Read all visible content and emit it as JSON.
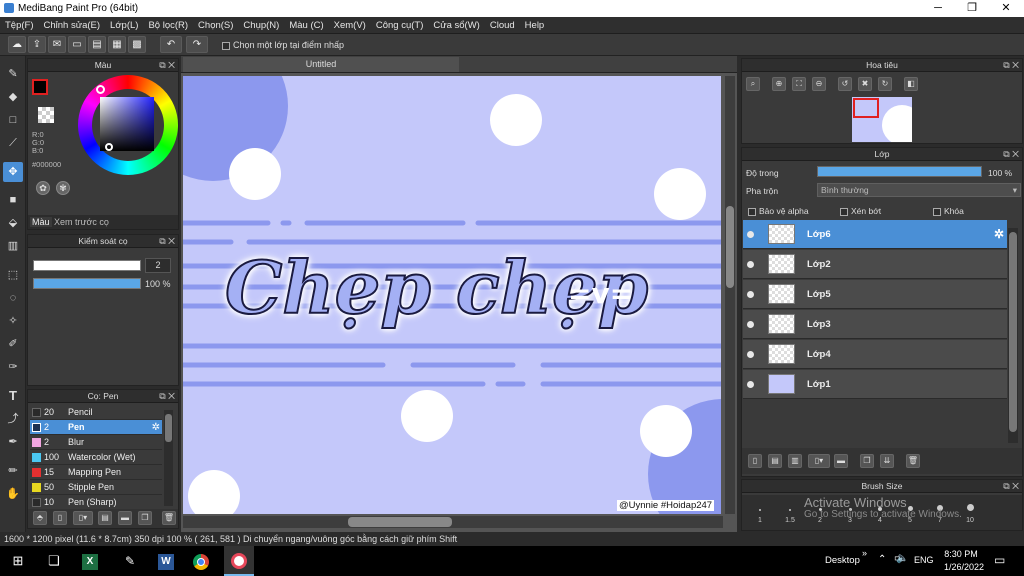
{
  "window": {
    "title": "MediBang Paint Pro (64bit)",
    "min": "─",
    "max": "❐",
    "close": "✕"
  },
  "menu": [
    "Tệp(F)",
    "Chỉnh sửa(E)",
    "Lớp(L)",
    "Bộ lọc(R)",
    "Chọn(S)",
    "Chụp(N)",
    "Màu (C)",
    "Xem(V)",
    "Công cụ(T)",
    "Cửa sổ(W)",
    "Cloud",
    "Help"
  ],
  "toolbar": {
    "checkbox_label": "Chọn một lớp tại điểm nhấp"
  },
  "color_panel": {
    "title": "Màu",
    "r": "R:0",
    "g": "G:0",
    "b": "B:0",
    "hex": "#000000",
    "tab_color": "Màu",
    "tab_preview": "Xem trước cọ",
    "fg_color": "#000000",
    "accent": "#4a8fd6"
  },
  "brush_control": {
    "title": "Kiểm soát cọ",
    "size": "2",
    "opacity": "100 %"
  },
  "brush_panel": {
    "title": "Cọ: Pen",
    "items": [
      {
        "size": "20",
        "name": "Pencil",
        "color": "#2a2a2a"
      },
      {
        "size": "2",
        "name": "Pen",
        "color": "#1d3050"
      },
      {
        "size": "2",
        "name": "Blur",
        "color": "#f2a6e0"
      },
      {
        "size": "100",
        "name": "Watercolor (Wet)",
        "color": "#4bc8f2"
      },
      {
        "size": "15",
        "name": "Mapping Pen",
        "color": "#e53030"
      },
      {
        "size": "50",
        "name": "Stipple Pen",
        "color": "#e8d820"
      },
      {
        "size": "10",
        "name": "Pen (Sharp)",
        "color": "#2a2a2a"
      }
    ]
  },
  "canvas": {
    "tab": "Untitled",
    "main_text": "Chẹp chẹp",
    "emote": "=v=",
    "watermark": "@Uynnie #Hoidap247",
    "bg": "#c4c8fa",
    "accent": "#8c98ee"
  },
  "navigator": {
    "title": "Hoa tiêu"
  },
  "layer_panel": {
    "title": "Lớp",
    "opacity_label": "Độ trong",
    "opacity_value": "100 %",
    "blend_label": "Pha trộn",
    "blend_value": "Bình thường",
    "opt_alpha": "Bảo vệ alpha",
    "opt_clip": "Xén bớt",
    "opt_lock": "Khóa",
    "layers": [
      "Lớp6",
      "Lớp2",
      "Lớp5",
      "Lớp3",
      "Lớp4",
      "Lớp1"
    ]
  },
  "brush_size": {
    "title": "Brush Size",
    "sizes": [
      "1",
      "1.5",
      "2",
      "3",
      "4",
      "5",
      "7",
      "10"
    ],
    "activate1": "Activate Windows",
    "activate2": "Go to Settings to activate Windows."
  },
  "status": {
    "text": "1600 * 1200 pixel   (11.6 * 8.7cm)   350 dpi   100 %   ( 261, 581 )   Di chuyển ngang/vuông góc bằng cách giữ phím Shift"
  },
  "taskbar": {
    "desktop": "Desktop",
    "lang": "ENG",
    "time": "8:30 PM",
    "date": "1/26/2022"
  }
}
